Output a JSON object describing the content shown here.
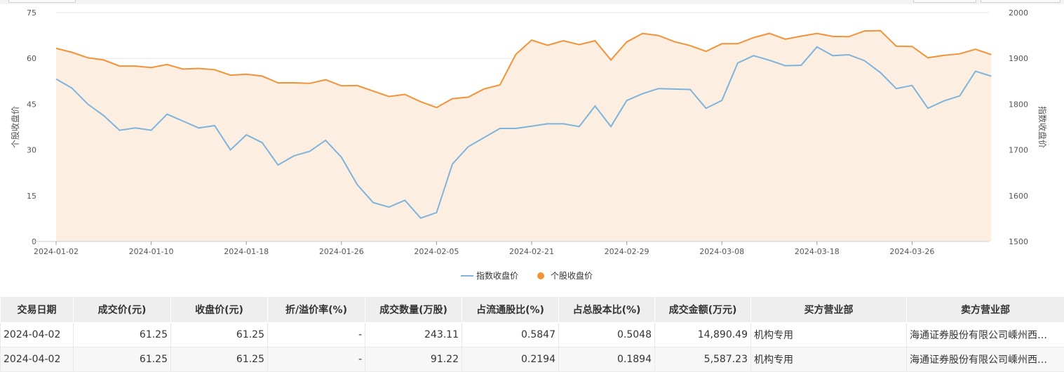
{
  "colors": {
    "index_line": "#7eb4dc",
    "stock_line": "#f39237",
    "stock_area": "#fdeee2",
    "grid": "#e6e6e6"
  },
  "legend": [
    {
      "label": "指数收盘价",
      "type": "line",
      "color": "#7eb4dc"
    },
    {
      "label": "个股收盘价",
      "type": "dot",
      "color": "#f39237"
    }
  ],
  "chart_data": {
    "type": "line",
    "xlabel": "",
    "y_left_label": "个股收盘价",
    "y_right_label": "指数收盘价",
    "ylim_left": [
      0,
      75
    ],
    "ylim_right": [
      1500,
      2000
    ],
    "yticks_left": [
      "0",
      "15",
      "30",
      "45",
      "60",
      "75"
    ],
    "yticks_right": [
      "1500",
      "1600",
      "1700",
      "1800",
      "1900",
      "2000"
    ],
    "xticks": [
      "2024-01-02",
      "2024-01-10",
      "2024-01-18",
      "2024-01-26",
      "2024-02-05",
      "2024-02-21",
      "2024-02-29",
      "2024-03-08",
      "2024-03-18",
      "2024-03-26"
    ],
    "grid": true,
    "legend_position": "bottom",
    "series": [
      {
        "name": "个股收盘价",
        "axis": "left",
        "area": true,
        "values": [
          63.3,
          62.0,
          60.2,
          59.5,
          57.5,
          57.5,
          57.0,
          58.0,
          56.5,
          56.7,
          56.3,
          54.5,
          54.8,
          54.2,
          52.0,
          52.0,
          51.8,
          53.0,
          51.0,
          51.1,
          49.3,
          47.5,
          48.2,
          45.8,
          43.9,
          46.8,
          47.3,
          50.0,
          51.3,
          61.3,
          66.0,
          64.3,
          65.8,
          64.5,
          65.8,
          59.5,
          65.4,
          68.2,
          67.5,
          65.5,
          64.2,
          62.3,
          64.8,
          64.8,
          66.8,
          68.2,
          66.3,
          67.3,
          68.2,
          67.2,
          67.1,
          69.0,
          69.1,
          64.0,
          63.9,
          60.2,
          61.0,
          61.5,
          63.0,
          61.25
        ]
      },
      {
        "name": "指数收盘价",
        "axis": "right",
        "values": [
          1855,
          1835,
          1800,
          1775,
          1743,
          1748,
          1743,
          1778,
          1763,
          1748,
          1753,
          1700,
          1733,
          1716,
          1667,
          1687,
          1697,
          1721,
          1684,
          1624,
          1585,
          1575,
          1590,
          1551,
          1563,
          1669,
          1707,
          1727,
          1747,
          1747,
          1752,
          1757,
          1757,
          1751,
          1796,
          1751,
          1808,
          1823,
          1834,
          1833,
          1832,
          1791,
          1808,
          1890,
          1906,
          1896,
          1884,
          1885,
          1925,
          1906,
          1908,
          1895,
          1869,
          1834,
          1841,
          1791,
          1807,
          1818,
          1872,
          1861
        ]
      }
    ]
  },
  "table": {
    "headers": [
      "交易日期",
      "成交价(元)",
      "收盘价(元)",
      "折/溢价率(%)",
      "成交数量(万股)",
      "占流通股比(%)",
      "占总股本比(%)",
      "成交金额(万元)",
      "买方营业部",
      "卖方营业部"
    ],
    "rows": [
      [
        "2024-04-02",
        "61.25",
        "61.25",
        "-",
        "243.11",
        "0.5847",
        "0.5048",
        "14,890.49",
        "机构专用",
        "海通证券股份有限公司嵊州西…"
      ],
      [
        "2024-04-02",
        "61.25",
        "61.25",
        "-",
        "91.22",
        "0.2194",
        "0.1894",
        "5,587.23",
        "机构专用",
        "海通证券股份有限公司嵊州西…"
      ]
    ]
  }
}
